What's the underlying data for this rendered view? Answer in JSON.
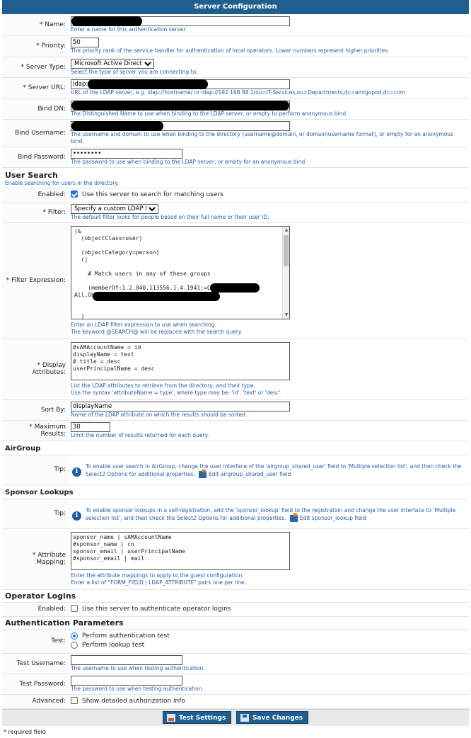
{
  "header": {
    "title": "Server Configuration"
  },
  "fields": {
    "name": {
      "label": "Name:",
      "help": "Enter a name for this authentication server."
    },
    "priority": {
      "label": "Priority:",
      "value": "50",
      "help": "The priority rank of the service handler for authentication of local operators. Lower numbers represent higher priorities."
    },
    "server_type": {
      "label": "Server Type:",
      "value": "Microsoft Active Directory",
      "help": "Select the type of server you are connecting to."
    },
    "server_url": {
      "label": "Server URL:",
      "value": "ldap:/",
      "help": "URL of the LDAP server, e.g. ldap://hostname/ or ldap://192.168.88.1/ou=IT-Services,ou=Departments,dc=amigopod,dc=com"
    },
    "bind_dn": {
      "label": "Bind DN:",
      "help": "The Distinguished Name to use when binding to the LDAP server, or empty to perform anonymous bind."
    },
    "bind_username": {
      "label": "Bind Username:",
      "help": "The username and domain to use when binding to the directory (username@domain, or domain\\username format), or empty for an anonymous bind."
    },
    "bind_password": {
      "label": "Bind Password:",
      "value": "••••••••",
      "help": "The password to use when binding to the LDAP server, or empty for an anonymous bind."
    }
  },
  "user_search": {
    "title": "User Search",
    "subtitle": "Enable searching for users in the directory.",
    "enabled_label": "Enabled:",
    "enabled_text": "Use this server to search for matching users",
    "filter_label": "Filter:",
    "filter_value": "Specify a custom LDAP filter...",
    "filter_help": "The default filter looks for people based on their full name or their user ID.",
    "filter_expr_label": "Filter Expression:",
    "filter_expr": "(&\n  (objectClass=user)\n\n  (objectCategory=person)\n  (|\n\n    # Match users in any of these groups\n\n    (memberOf:1.2.840.113556.1.4.1941:=CN\nAll,OU\n\n\n  )\n  )",
    "filter_expr_help1": "Enter an LDAP filter expression to use when searching.",
    "filter_expr_help2": "The keyword @SEARCH@ will be replaced with the search query.",
    "display_attr_label": "Display Attributes:",
    "display_attr": "#sAMAccountName = id\ndisplayName = text\n# title = desc\nuserPrincipalName = desc",
    "display_attr_help1": "List the LDAP attributes to retrieve from the directory, and their type.",
    "display_attr_help2": "Use the syntax 'attributeName = type', where type may be: 'id', 'text' or 'desc'.",
    "sort_by_label": "Sort By:",
    "sort_by_value": "displayName",
    "sort_by_help": "Name of the LDAP attribute on which the results should be sorted.",
    "max_results_label": "Maximum Results:",
    "max_results_value": "30",
    "max_results_help": "Limit the number of results returned for each query."
  },
  "airgroup": {
    "title": "AirGroup",
    "tip_label": "Tip:",
    "tip_text": "To enable user search in AirGroup, change the user interface of the 'airgroup_shared_user' field to 'Multiple selection list', and then check the Select2 Options for additional properties.",
    "edit_link": "Edit airgroup_shared_user field"
  },
  "sponsor": {
    "title": "Sponsor Lookups",
    "tip_label": "Tip:",
    "tip_text": "To enable sponsor lookups in a self-registration, add the 'sponsor_lookup' field to the registration and change the user interface to 'Multiple selection list', and then check the Select2 Options for additional properties.",
    "edit_link": "Edit sponsor_lookup field",
    "mapping_label": "Attribute Mapping:",
    "mapping": "sponsor_name | sAMAccountName\n#sponsor_name | cn\nsponsor_email | userPrincipalName\n#sponsor_email | mail",
    "mapping_help1": "Enter the attribute mappings to apply to the guest configuration.",
    "mapping_help2": "Enter a list of \"FORM_FIELD | LDAP_ATTRIBUTE\" pairs one per line."
  },
  "operator": {
    "title": "Operator Logins",
    "enabled_label": "Enabled:",
    "enabled_text": "Use this server to authenticate operator logins"
  },
  "auth": {
    "title": "Authentication Parameters",
    "test_label": "Test:",
    "opt1": "Perform authentication test",
    "opt2": "Perform lookup test",
    "test_user_label": "Test Username:",
    "test_user_help": "The username to use when testing authentication.",
    "test_pass_label": "Test Password:",
    "test_pass_help": "The password to use when testing authentication.",
    "advanced_label": "Advanced:",
    "advanced_text": "Show detailed authorization info"
  },
  "buttons": {
    "test": "Test Settings",
    "save": "Save Changes"
  },
  "footer": {
    "required_note": "* required field"
  },
  "colors": {
    "header": "#1f5f8f",
    "help": "#2a5ca8",
    "accent": "#1a73e8"
  }
}
